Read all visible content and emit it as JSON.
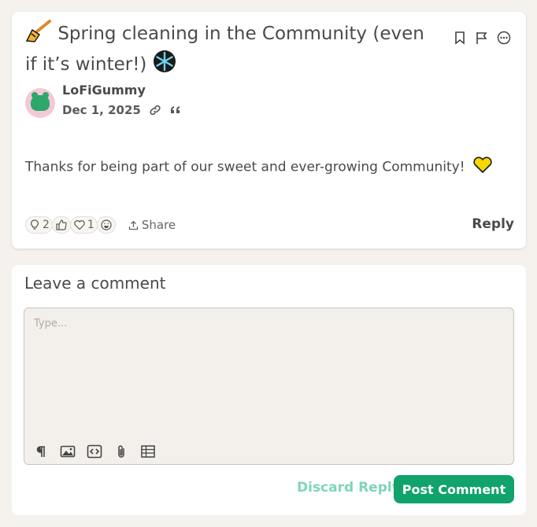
{
  "post": {
    "title": "Spring cleaning in the Community (even if it’s winter!)",
    "author": "LoFiGummy",
    "date": "Dec 1, 2025",
    "body": "Thanks for being part of our sweet and ever-growing Community!",
    "reactions": {
      "idea_count": "2",
      "heart_count": "1"
    },
    "share_label": "Share",
    "reply_label": "Reply"
  },
  "comment": {
    "heading": "Leave a comment",
    "placeholder": "Type...",
    "discard_label": "Discard Reply",
    "post_label": "Post Comment"
  },
  "colors": {
    "accent": "#10a36c",
    "discard": "#7fd6b6",
    "background": "#f5f2ee",
    "heart": "#f5d800"
  }
}
